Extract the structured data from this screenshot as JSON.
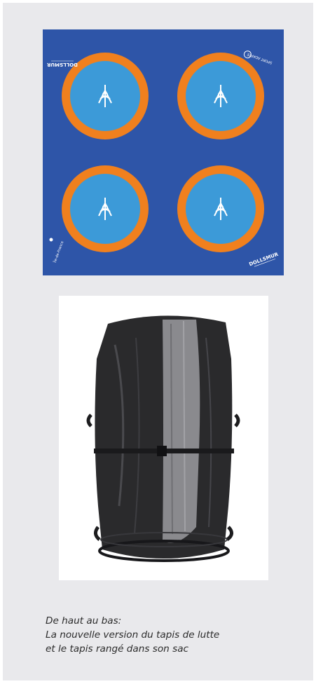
{
  "mat": {
    "background_color": "#2e55a8",
    "ring_color": "#f0801e",
    "circle_color": "#3c9ad8",
    "circle_count": 4,
    "logo_text": "DOLLSMUR",
    "sponsor_text": "Région Île-de-France",
    "federation_text": "SPORT ADAPTÉ"
  },
  "bag": {
    "background_color": "#ffffff",
    "bag_color": "#2a2a2c",
    "foam_color": "#8a8a8e"
  },
  "caption": {
    "line1": "De haut au bas:",
    "line2": "La nouvelle version du tapis de lutte",
    "line3": "et le tapis rangé dans son sac"
  }
}
